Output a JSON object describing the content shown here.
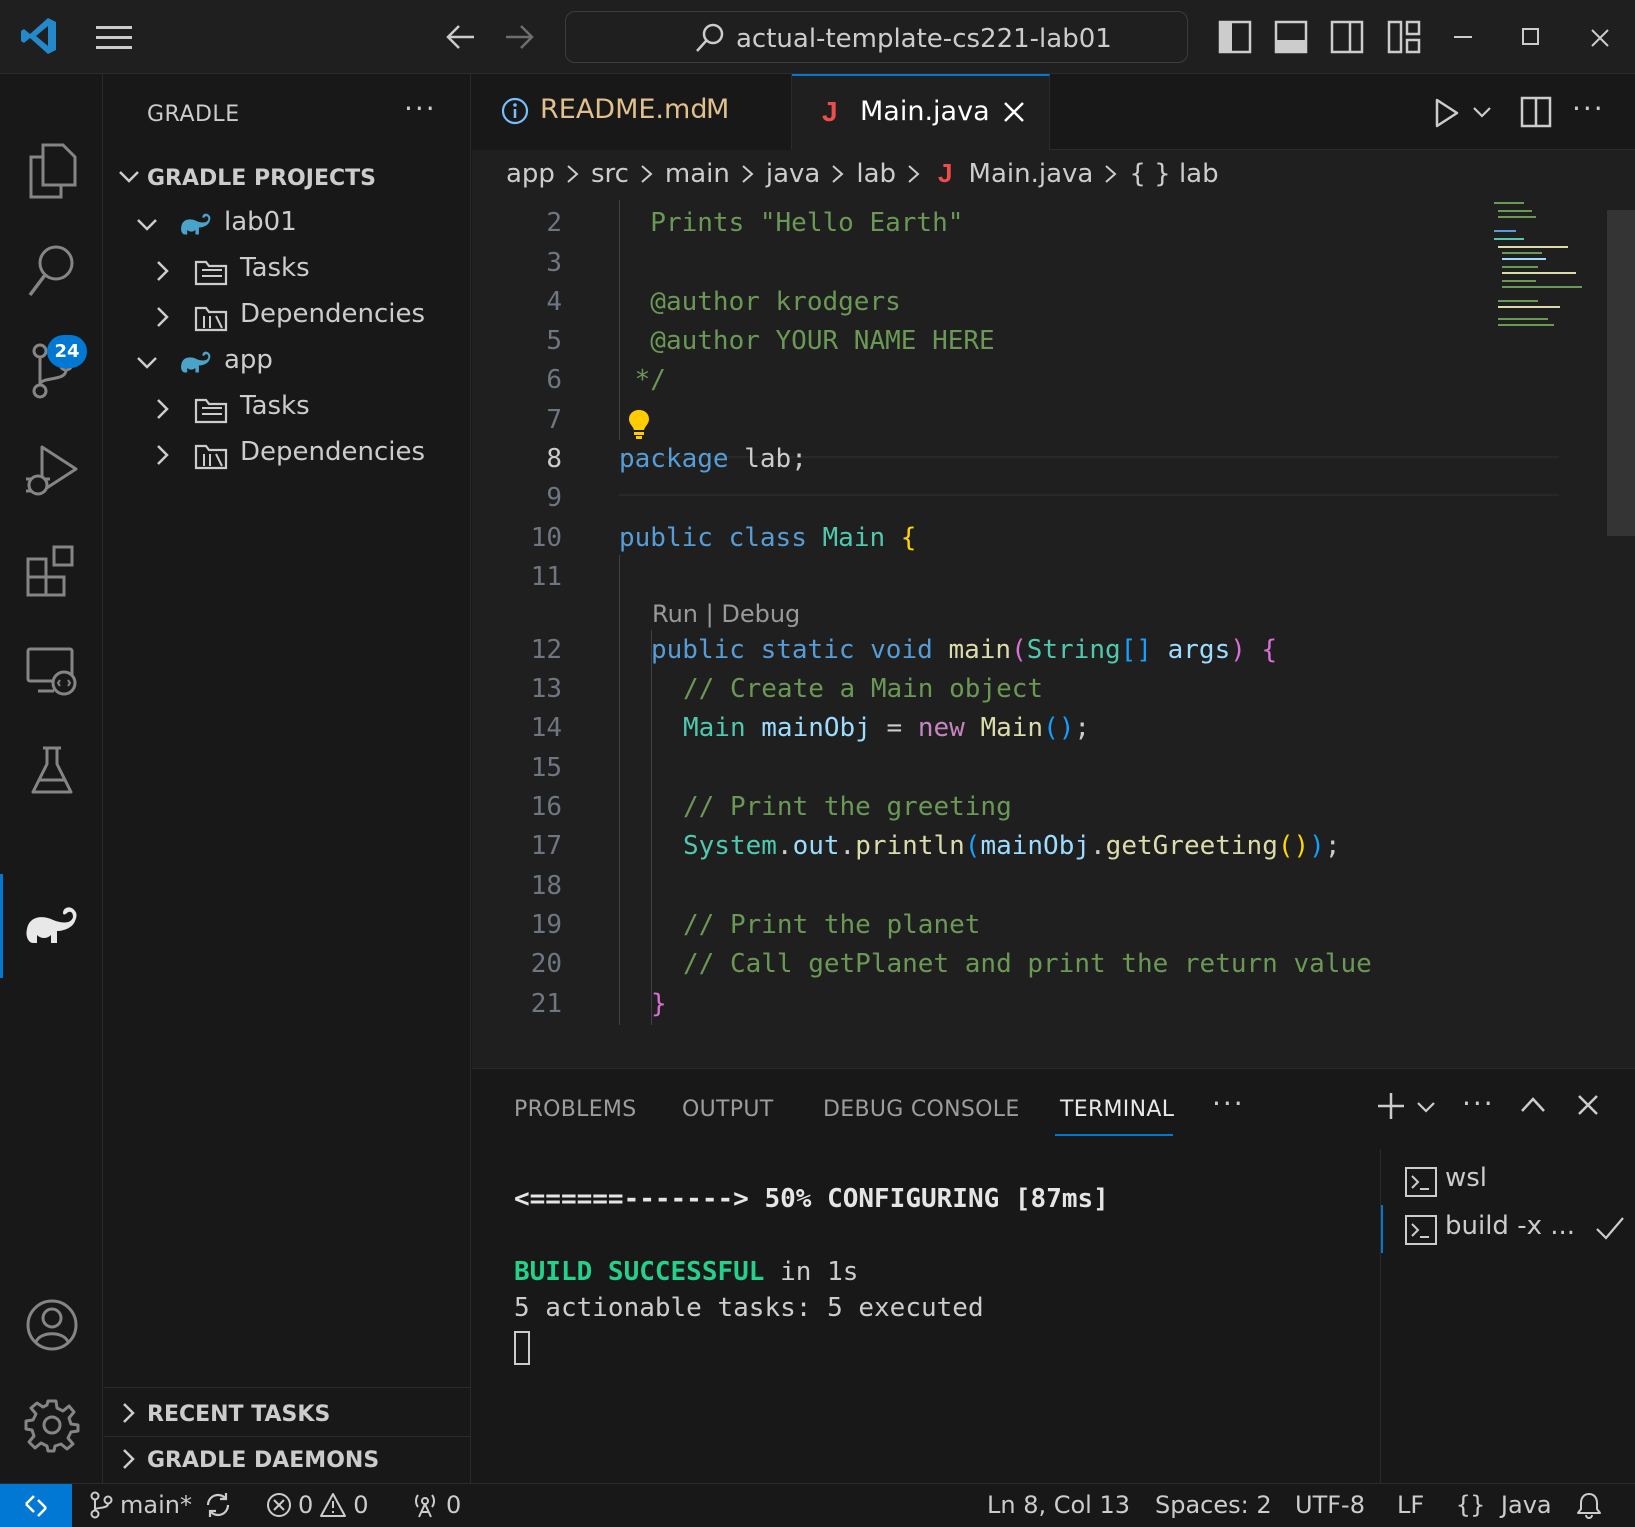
{
  "titlebar": {
    "back_icon": "arrow-left-icon",
    "forward_icon": "arrow-right-icon",
    "search_text": "actual-template-cs221-lab01"
  },
  "activity_bar": {
    "items": [
      "explorer-icon",
      "search-icon",
      "source-control-icon",
      "run-debug-icon",
      "extensions-icon",
      "remote-explorer-icon",
      "testing-icon",
      "gradle-icon"
    ],
    "scm_badge": "24",
    "bottom": [
      "accounts-icon",
      "manage-gear-icon"
    ]
  },
  "sidebar": {
    "title": "GRADLE",
    "more": "···",
    "section_projects": "GRADLE PROJECTS",
    "tree": [
      {
        "label": "lab01",
        "kind": "project"
      },
      {
        "label": "Tasks",
        "kind": "folder"
      },
      {
        "label": "Dependencies",
        "kind": "deps"
      },
      {
        "label": "app",
        "kind": "project"
      },
      {
        "label": "Tasks",
        "kind": "folder"
      },
      {
        "label": "Dependencies",
        "kind": "deps"
      }
    ],
    "section_recent": "RECENT TASKS",
    "section_daemons": "GRADLE DAEMONS"
  },
  "tabs": {
    "readme": {
      "label": "README.md",
      "badge": "M"
    },
    "main": {
      "label": "Main.java"
    }
  },
  "breadcrumb": {
    "parts": [
      "app",
      "src",
      "main",
      "java",
      "lab",
      "Main.java",
      "{ } lab"
    ]
  },
  "editor": {
    "line_numbers": [
      "2",
      "3",
      "4",
      "5",
      "6",
      "7",
      "8",
      "9",
      "10",
      "11",
      "12",
      "13",
      "14",
      "15",
      "16",
      "17",
      "18",
      "19",
      "20",
      "21"
    ],
    "current_line": "8",
    "codelens": "Run | Debug",
    "code": {
      "l2": "  Prints \"Hello Earth\"",
      "l4": "  @author krodgers",
      "l5": "  @author YOUR NAME HERE",
      "l6": " */",
      "l8_kw": "package",
      "l8_rest": " lab;",
      "l10_kw1": "public",
      "l10_kw2": "class",
      "l10_ty": "Main",
      "l10_br": "{",
      "l12_kw1": "public",
      "l12_kw2": "static",
      "l12_kw3": "void",
      "l12_fn": "main",
      "l12_p1": "(",
      "l12_ty": "String",
      "l12_arr": "[]",
      "l12_var": "args",
      "l12_p2": ")",
      "l12_br": "{",
      "l13": "// Create a Main object",
      "l14_ty": "Main",
      "l14_var": "mainObj",
      "l14_eq": " = ",
      "l14_new": "new",
      "l14_fn": "Main",
      "l14_paren": "()",
      "l14_end": ";",
      "l16": "// Print the greeting",
      "l17_ty": "System",
      "l17_dot1": ".",
      "l17_out": "out",
      "l17_dot2": ".",
      "l17_fn": "println",
      "l17_p1": "(",
      "l17_var": "mainObj",
      "l17_dot3": ".",
      "l17_fn2": "getGreeting",
      "l17_p2": "()",
      "l17_p3": ")",
      "l17_end": ";",
      "l19": "// Print the planet",
      "l20": "// Call getPlanet and print the return value",
      "l21": "}"
    }
  },
  "panel": {
    "tabs": [
      "PROBLEMS",
      "OUTPUT",
      "DEBUG CONSOLE",
      "TERMINAL"
    ],
    "active_tab": "TERMINAL",
    "more": "···",
    "terminal_lines": {
      "progress": "<======-------> 50% CONFIGURING [87ms]",
      "build_word": "BUILD SUCCESSFUL",
      "build_rest": " in 1s",
      "tasks": "5 actionable tasks: 5 executed"
    },
    "terminals": [
      {
        "label": "wsl"
      },
      {
        "label": "build -x ..."
      }
    ]
  },
  "statusbar": {
    "branch": "main*",
    "errors": "0",
    "warnings": "0",
    "ports": "0",
    "position": "Ln 8, Col 13",
    "spaces": "Spaces: 2",
    "encoding": "UTF-8",
    "eol": "LF",
    "language": "Java"
  },
  "colors": {
    "accent": "#0078d4",
    "comment": "#6a9955",
    "keyword": "#569cd6",
    "type": "#4ec9b0",
    "function": "#dcdcaa",
    "variable": "#9cdcfe",
    "modified": "#e2c08d",
    "terminal_success": "#23d18b"
  }
}
